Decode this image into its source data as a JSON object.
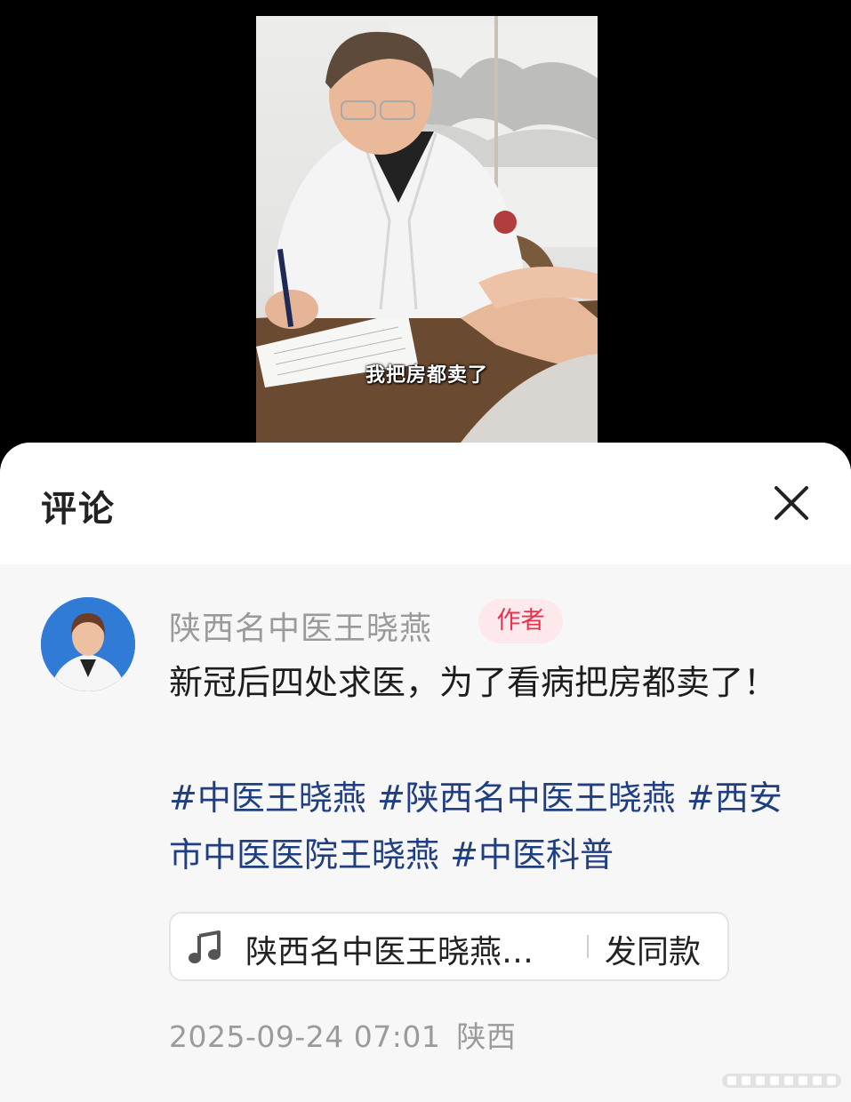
{
  "video": {
    "caption": "我把房都卖了"
  },
  "sheet": {
    "title": "评论"
  },
  "comment": {
    "author": "陕西名中医王晓燕",
    "badge": "作者",
    "text": "新冠后四处求医，为了看病把房都卖了！",
    "tags": [
      "#中医王晓燕",
      "#陕西名中医王晓燕",
      "#西安市中医医院王晓燕",
      "#中医科普"
    ],
    "music": {
      "icon": "music-note-icon",
      "title": "陕西名中医王晓燕…",
      "action": "发同款"
    },
    "date": "2025-09-24 07:01",
    "location": "陕西"
  },
  "colors": {
    "tag": "#1f3f82",
    "badge_text": "#e8334f",
    "badge_bg": "#fde8ec",
    "meta": "#9b9b9b"
  }
}
